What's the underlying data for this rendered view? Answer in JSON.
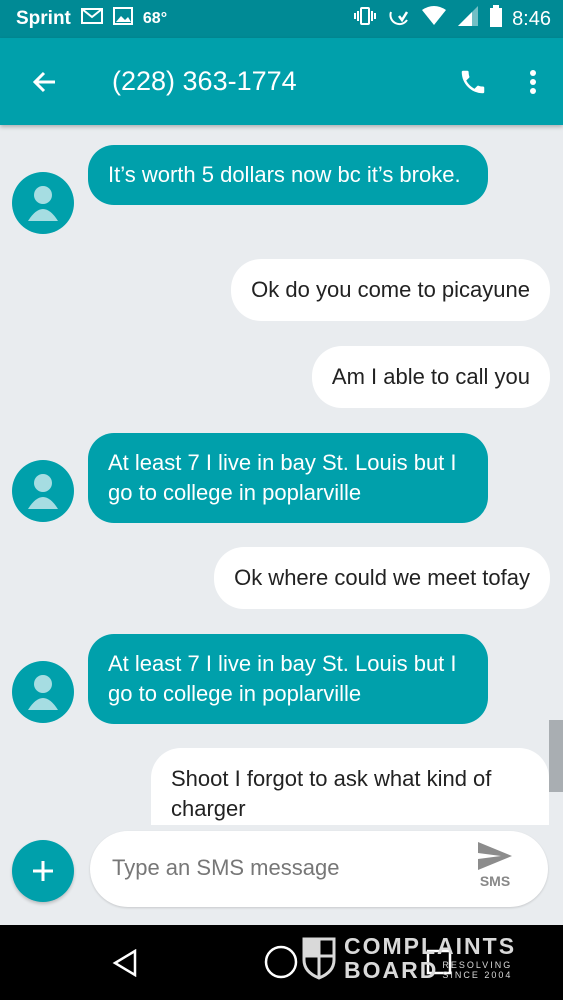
{
  "status_bar": {
    "carrier": "Sprint",
    "temperature": "68°",
    "time": "8:46"
  },
  "app_bar": {
    "title": "(228) 363-1774",
    "icons": [
      "back-arrow-icon",
      "phone-icon",
      "more-vert-icon"
    ]
  },
  "messages": [
    {
      "dir": "in",
      "text": "It’s worth 5 dollars now bc it’s broke."
    },
    {
      "dir": "out",
      "text": "Ok do you come to picayune"
    },
    {
      "dir": "out",
      "text": "Am I able to call you"
    },
    {
      "dir": "in",
      "text": "At least 7 I live in bay St. Louis but I go to college in poplarville"
    },
    {
      "dir": "out",
      "text": "Ok where could we meet tofay"
    },
    {
      "dir": "in",
      "text": "At least 7 I live in bay St. Louis but I go to college in poplarville"
    },
    {
      "dir": "out",
      "text": "Shoot I forgot to ask what kind of charger"
    }
  ],
  "composer": {
    "placeholder": "Type an SMS message",
    "send_label": "SMS"
  },
  "watermark": {
    "line1": "COMPLAINTS",
    "line2": "BOARD",
    "tagline1": "RESOLVING",
    "tagline2": "SINCE 2004"
  },
  "colors": {
    "status_bar": "#008a95",
    "app_bar": "#00a0ab",
    "incoming_bubble": "#00a0ab",
    "outgoing_bubble": "#ffffff",
    "background": "#e9ecef"
  }
}
